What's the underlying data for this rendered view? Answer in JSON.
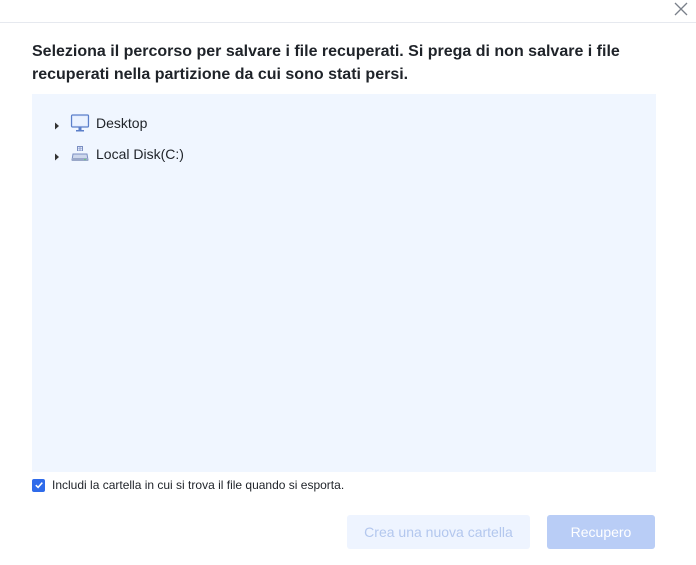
{
  "dialog": {
    "title": "Seleziona il percorso per salvare i file recuperati. Si prega di non salvare i file recuperati nella partizione da cui sono stati persi."
  },
  "tree": {
    "items": [
      {
        "label": "Desktop",
        "icon": "monitor-icon"
      },
      {
        "label": "Local Disk(C:)",
        "icon": "drive-icon"
      }
    ]
  },
  "options": {
    "include_folder_label": "Includi la cartella in cui si trova il file quando si esporta.",
    "include_folder_checked": true
  },
  "buttons": {
    "new_folder_label": "Crea una nuova cartella",
    "recover_label": "Recupero"
  },
  "colors": {
    "accent": "#2f6bea",
    "tree_background": "#f0f6ff",
    "primary_button_disabled": "#b9cdf6"
  }
}
